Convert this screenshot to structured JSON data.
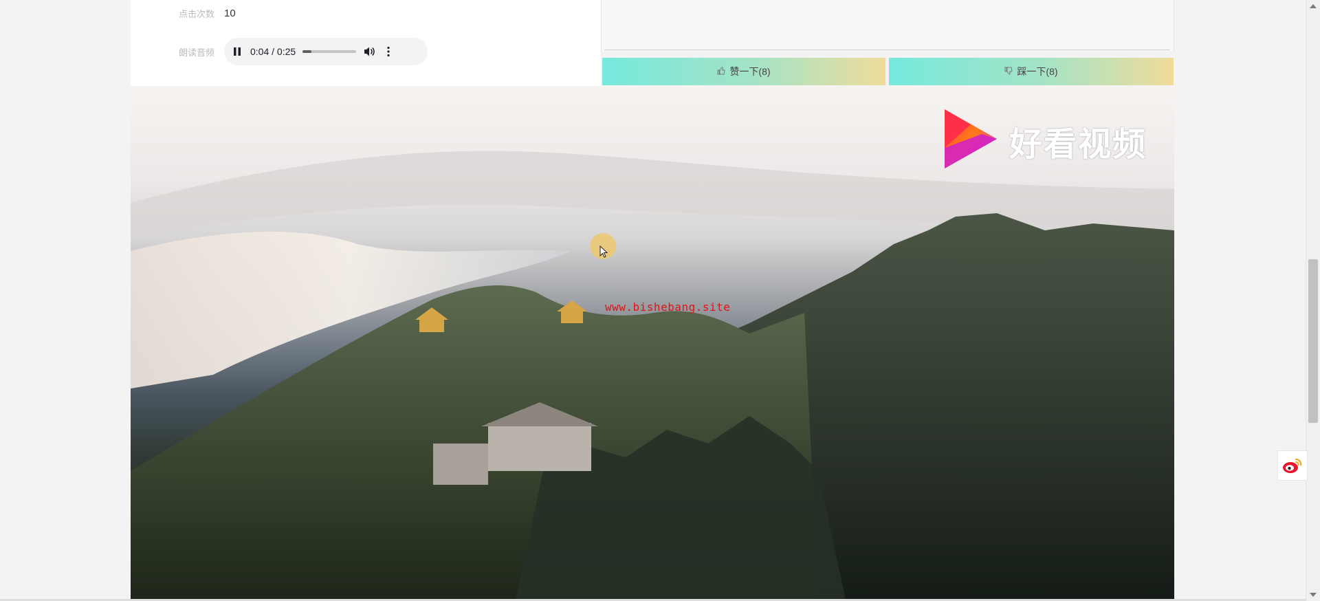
{
  "details": {
    "clicks_label": "点击次数",
    "clicks_value": "10",
    "audio_label": "朗读音频"
  },
  "audio": {
    "time": "0:04 / 0:25",
    "progress": 0.16,
    "pause_icon": "pause-icon",
    "volume_icon": "volume-icon",
    "more_icon": "more-vert-icon"
  },
  "actions": {
    "like_label": "赞一下(8)",
    "collect_label": "踩一下(8)",
    "like_icon": "thumbs-up-icon",
    "collect_icon": "thumbs-down-icon"
  },
  "video": {
    "brand_text": "好看视频",
    "watermark": "www.bishebang.site"
  },
  "colors": {
    "button_gradient_start": "#76e9dd",
    "button_gradient_end": "#f0dc9a",
    "watermark": "#e01414"
  }
}
